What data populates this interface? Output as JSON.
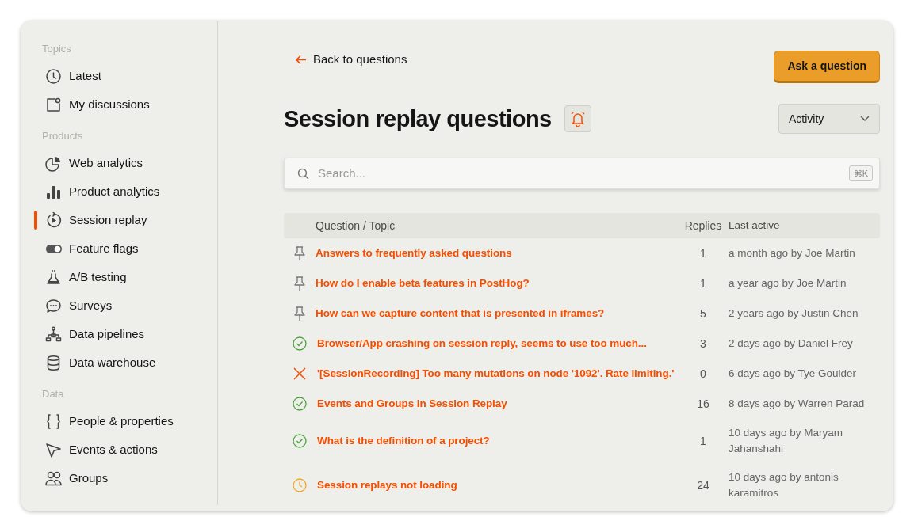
{
  "sidebar": {
    "sections": [
      {
        "heading": "Topics",
        "items": [
          {
            "label": "Latest",
            "selected": false
          },
          {
            "label": "My discussions",
            "selected": false
          }
        ]
      },
      {
        "heading": "Products",
        "items": [
          {
            "label": "Web analytics",
            "selected": false
          },
          {
            "label": "Product analytics",
            "selected": false
          },
          {
            "label": "Session replay",
            "selected": true
          },
          {
            "label": "Feature flags",
            "selected": false
          },
          {
            "label": "A/B testing",
            "selected": false
          },
          {
            "label": "Surveys",
            "selected": false
          },
          {
            "label": "Data pipelines",
            "selected": false
          },
          {
            "label": "Data warehouse",
            "selected": false
          }
        ]
      },
      {
        "heading": "Data",
        "items": [
          {
            "label": "People & properties",
            "selected": false
          },
          {
            "label": "Events & actions",
            "selected": false
          },
          {
            "label": "Groups",
            "selected": false
          }
        ]
      }
    ]
  },
  "back_link": "Back to questions",
  "ask_button": "Ask a question",
  "title": "Session replay questions",
  "sort": {
    "value": "Activity"
  },
  "search": {
    "placeholder": "Search...",
    "shortcut": "⌘K"
  },
  "table": {
    "columns": [
      "Question / Topic",
      "Replies",
      "Last active"
    ],
    "rows": [
      {
        "kind": "pinned",
        "title": "Answers to frequently asked questions",
        "replies": "1",
        "last_active": "a month ago by Joe Martin"
      },
      {
        "kind": "pinned",
        "title": "How do I enable beta features in PostHog?",
        "replies": "1",
        "last_active": "a year ago by Joe Martin"
      },
      {
        "kind": "pinned",
        "title": "How can we capture content that is presented in iframes?",
        "replies": "5",
        "last_active": "2 years ago by Justin Chen"
      },
      {
        "kind": "resolved",
        "title": "Browser/App crashing on session reply, seems to use too much...",
        "replies": "3",
        "last_active": "2 days ago by Daniel Frey"
      },
      {
        "kind": "closed",
        "title": "'[SessionRecording] Too many mutations on node '1092'. Rate limiting.'",
        "replies": "0",
        "last_active": "6 days ago by Tye Goulder"
      },
      {
        "kind": "resolved",
        "title": "Events and Groups in Session Replay",
        "replies": "16",
        "last_active": "8 days ago by Warren Parad"
      },
      {
        "kind": "resolved",
        "title": "What is the definition of a project?",
        "replies": "1",
        "last_active": "10 days ago by Maryam Jahanshahi"
      },
      {
        "kind": "pending",
        "title": "Session replays not loading",
        "replies": "24",
        "last_active": "10 days ago by antonis karamitros"
      }
    ]
  }
}
